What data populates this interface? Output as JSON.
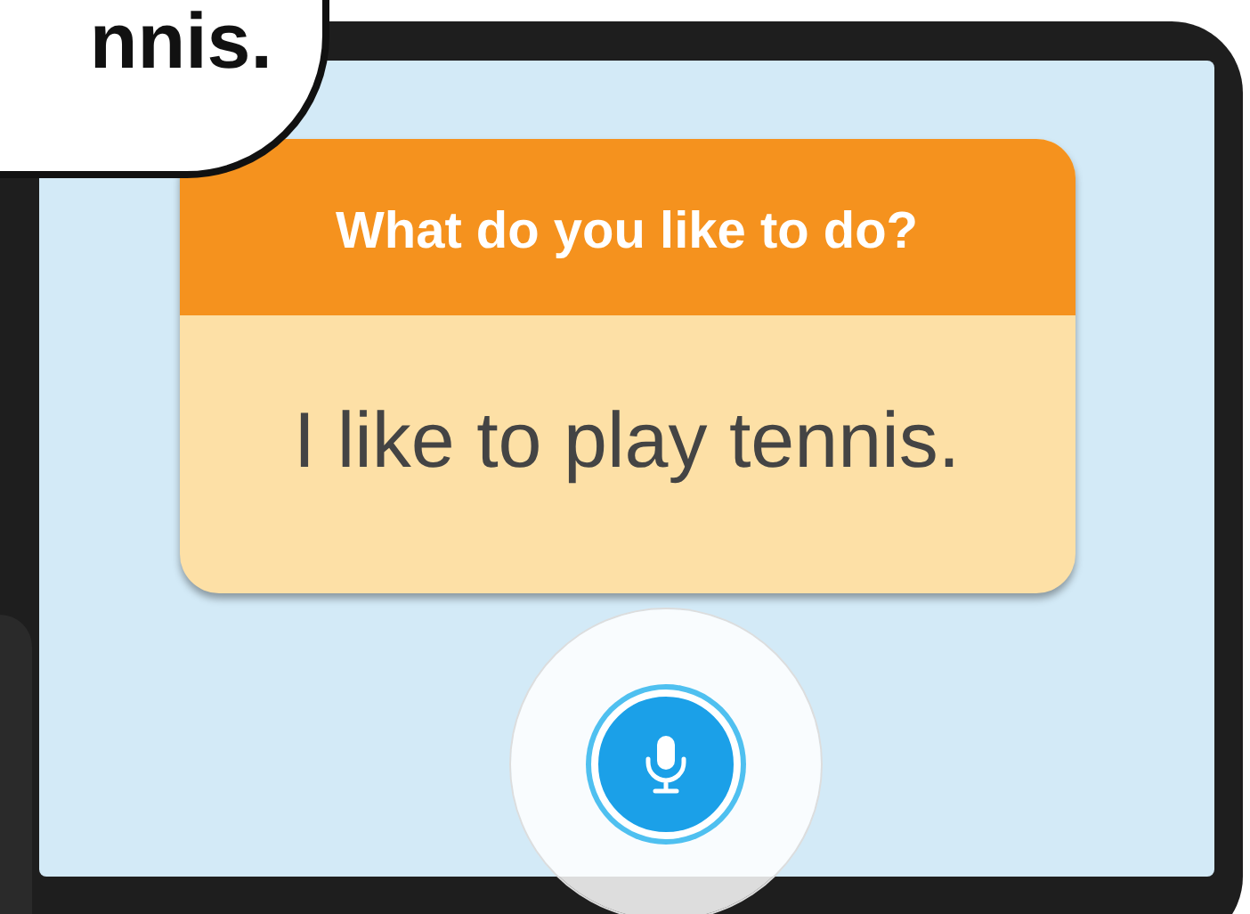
{
  "speech_bubble": {
    "text": "nnis."
  },
  "tablet": {
    "card": {
      "question": "What do you like to do?",
      "answer": "I like to play tennis."
    }
  }
}
